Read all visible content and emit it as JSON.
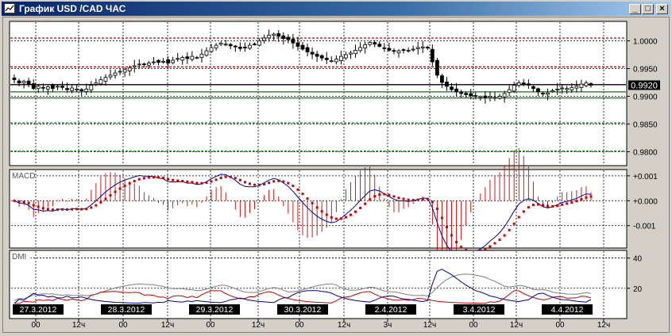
{
  "window": {
    "title": "График USD /CAD  ЧАС",
    "buttons": {
      "minimize": "_",
      "maximize": "□",
      "close": "×"
    }
  },
  "chart_data": [
    {
      "type": "candlestick",
      "panel": "price",
      "ylim": [
        0.9775,
        1.0035
      ],
      "y_ticks": [
        "1.0000",
        "0.9950",
        "0.9900",
        "0.9850",
        "0.9800"
      ],
      "current_price_label": "0.9920",
      "current_price": 0.992,
      "horizontal_lines": [
        {
          "value": 1.0005,
          "color": "#c00000",
          "style": "dashed"
        },
        {
          "value": 0.9953,
          "color": "#c00000",
          "style": "dashed"
        },
        {
          "value": 0.9921,
          "color": "#000000",
          "style": "solid"
        },
        {
          "value": 0.9908,
          "color": "#008000",
          "style": "solid"
        },
        {
          "value": 0.9897,
          "color": "#008000",
          "style": "solid"
        },
        {
          "value": 0.9852,
          "color": "#008000",
          "style": "dashed"
        },
        {
          "value": 0.9801,
          "color": "#008000",
          "style": "dashed"
        }
      ],
      "closes": [
        0.993,
        0.9924,
        0.9927,
        0.9921,
        0.9914,
        0.9918,
        0.9915,
        0.9917,
        0.9914,
        0.9918,
        0.9916,
        0.9912,
        0.9915,
        0.9913,
        0.991,
        0.9913,
        0.992,
        0.9924,
        0.993,
        0.9934,
        0.9938,
        0.9942,
        0.9945,
        0.9948,
        0.9951,
        0.9955,
        0.9958,
        0.9957,
        0.996,
        0.9962,
        0.9961,
        0.9963,
        0.996,
        0.9965,
        0.9968,
        0.997,
        0.9968,
        0.9972,
        0.997,
        0.9976,
        0.9982,
        0.9988,
        0.9992,
        0.9996,
        0.9994,
        0.9991,
        0.9989,
        0.9986,
        0.9988,
        0.9992,
        0.9994,
        1.0,
        1.0005,
        1.001,
        1.0012,
        1.0008,
        1.0004,
        1.0002,
        0.9996,
        0.999,
        0.9985,
        0.998,
        0.9976,
        0.9972,
        0.9969,
        0.9966,
        0.9964,
        0.9967,
        0.9972,
        0.9975,
        0.9978,
        0.9983,
        0.9988,
        0.9993,
        0.9997,
        0.9994,
        0.999,
        0.9986,
        0.9983,
        0.9981,
        0.9982,
        0.9984,
        0.9983,
        0.9985,
        0.9988,
        0.9989,
        0.9987,
        0.9962,
        0.9938,
        0.9925,
        0.9918,
        0.9912,
        0.9908,
        0.9905,
        0.9903,
        0.9901,
        0.99,
        0.9898,
        0.9897,
        0.9899,
        0.9898,
        0.99,
        0.9905,
        0.9912,
        0.992,
        0.9924,
        0.9922,
        0.992,
        0.9914,
        0.9908,
        0.9904,
        0.9906,
        0.991,
        0.9913,
        0.9915,
        0.9914,
        0.9916,
        0.9918,
        0.9922,
        0.9924,
        0.992
      ],
      "macd": {
        "y_ticks": [
          "+0.001",
          "+0.000",
          "-0.001"
        ],
        "ylim": [
          -0.0019,
          0.00125
        ]
      },
      "dmi": {
        "label": "DMI",
        "y_ticks": [
          "40",
          "20"
        ],
        "ylim": [
          0,
          45
        ]
      }
    }
  ],
  "panels": {
    "macd_label": "MACD",
    "dmi_label": "DMI"
  },
  "x_axis": {
    "dates": [
      "27.3.2012",
      "28.3.2012",
      "29.3.2012",
      "30.3.2012",
      "2.4.2012",
      "3.4.2012",
      "4.4.2012"
    ],
    "hour_labels": [
      "00",
      "12ч",
      "00",
      "12ч",
      "00",
      "12ч",
      "00",
      "12ч",
      "3ч",
      "12ч",
      "00",
      "12ч",
      "00",
      "12ч"
    ]
  },
  "colors": {
    "background": "#ffffff",
    "candle": "#000000",
    "macd_line": "#0000a0",
    "signal_dots": "#d00000",
    "histogram": "#d00000",
    "dmi_plus": "#d00000",
    "dmi_minus": "#0000a0",
    "adx": "#808080",
    "grid": "#000000"
  }
}
